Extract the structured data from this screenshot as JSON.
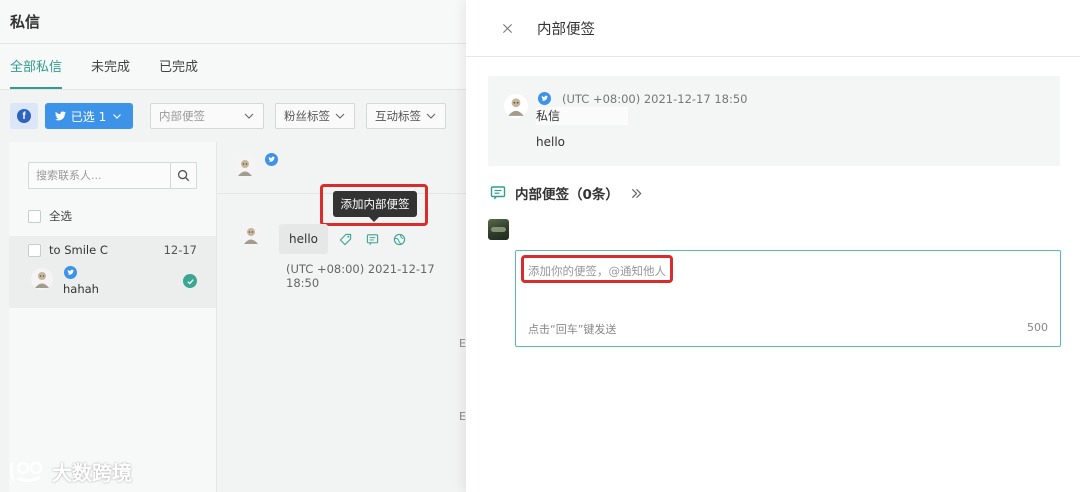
{
  "app": {
    "title": "私信",
    "tabs": [
      {
        "label": "全部私信",
        "active": true
      },
      {
        "label": "未完成",
        "active": false
      },
      {
        "label": "已完成",
        "active": false
      }
    ],
    "toolbar": {
      "facebook_icon": "facebook-icon",
      "twitter_selected_label": "已选 1",
      "notes_filter_placeholder": "内部便签",
      "fan_tags_label": "粉丝标签",
      "interaction_tags_label": "互动标签"
    },
    "contacts": {
      "search_placeholder": "搜索联系人...",
      "select_all_label": "全选",
      "items": [
        {
          "to": "to Smile C",
          "date": "12-17",
          "name": "hahah",
          "done": true
        }
      ]
    },
    "chat": {
      "message_text": "hello",
      "message_time": "(UTC +08:00)  2021-12-17 18:50",
      "tooltip": "添加内部便签"
    }
  },
  "drawer": {
    "title": "内部便签",
    "message": {
      "time": "(UTC +08:00)  2021-12-17 18:50",
      "type": "私信",
      "text": "hello"
    },
    "notes": {
      "title": "内部便签",
      "count_label": "（0条）",
      "input_placeholder": "添加你的便签，@通知他人",
      "hint": "点击“回车”键发送",
      "limit": "500"
    }
  },
  "watermark": {
    "text": "大数跨境"
  },
  "colors": {
    "accent": "#2f9e8f",
    "twitter": "#3d93e8",
    "facebook": "#2e63c2",
    "highlight": "#d92c2c"
  }
}
